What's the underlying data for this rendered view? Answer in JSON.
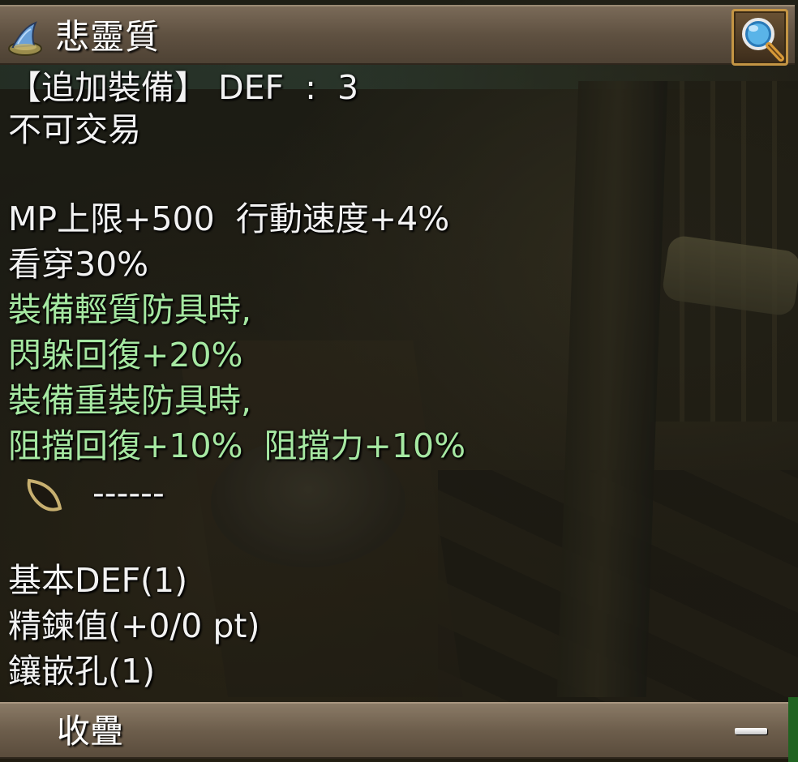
{
  "header": {
    "item_name": "悲靈質",
    "item_icon": "wizard-hat-icon",
    "zoom_icon": "magnifier-icon"
  },
  "tooltip": {
    "lines": [
      "【追加裝備】 DEF  :  3",
      "不可交易",
      "",
      "MP上限+500  行動速度+4%",
      "看穿30%",
      "裝備輕質防具時,",
      "閃躲回復+20%",
      "裝備重裝防具時,",
      "阻擋回復+10%  阻擋力+10%"
    ],
    "socket": {
      "icon": "empty-socket-icon",
      "text": "------"
    },
    "stats": [
      "基本DEF(1)",
      "精鍊值(+0/0 pt)",
      "鑲嵌孔(1)"
    ]
  },
  "footer": {
    "label": "收疊",
    "collapse_icon": "minus-icon"
  },
  "colors": {
    "text_white": "#f2f2f2",
    "text_green": "#a6e8a2",
    "header_bg": "#5f5141",
    "button_border": "#c49544"
  }
}
